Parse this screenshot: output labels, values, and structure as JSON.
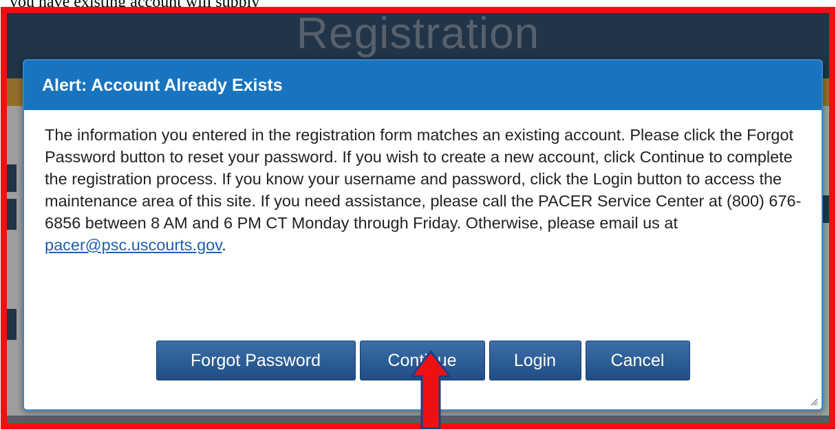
{
  "doc_text": "you have existing account will supply",
  "background": {
    "page_title": "Registration",
    "colors": {
      "header": "#1c3e63",
      "strip": "#e9a92a",
      "frame": "#ee1111"
    }
  },
  "modal": {
    "title": "Alert: Account Already Exists",
    "body_text": "The information you entered in the registration form matches an existing account. Please click the Forgot Password button to reset your password. If you wish to create a new account, click Continue to complete the registration process. If you know your username and password, click the Login button to access the maintenance area of this site. If you need assistance, please call the PACER Service Center at (800) 676-6856 between 8 AM and 6 PM CT Monday through Friday. Otherwise, please email us at",
    "email_link": "pacer@psc.uscourts.gov",
    "body_end": ".",
    "buttons": {
      "forgot_password": "Forgot Password",
      "continue": "Continue",
      "login": "Login",
      "cancel": "Cancel"
    },
    "colors": {
      "header": "#1874bf",
      "button": "#2a5a92",
      "link": "#1a5fb4"
    }
  },
  "annotation": {
    "arrow_color": "#ee1111",
    "points_to": "continue-button"
  }
}
